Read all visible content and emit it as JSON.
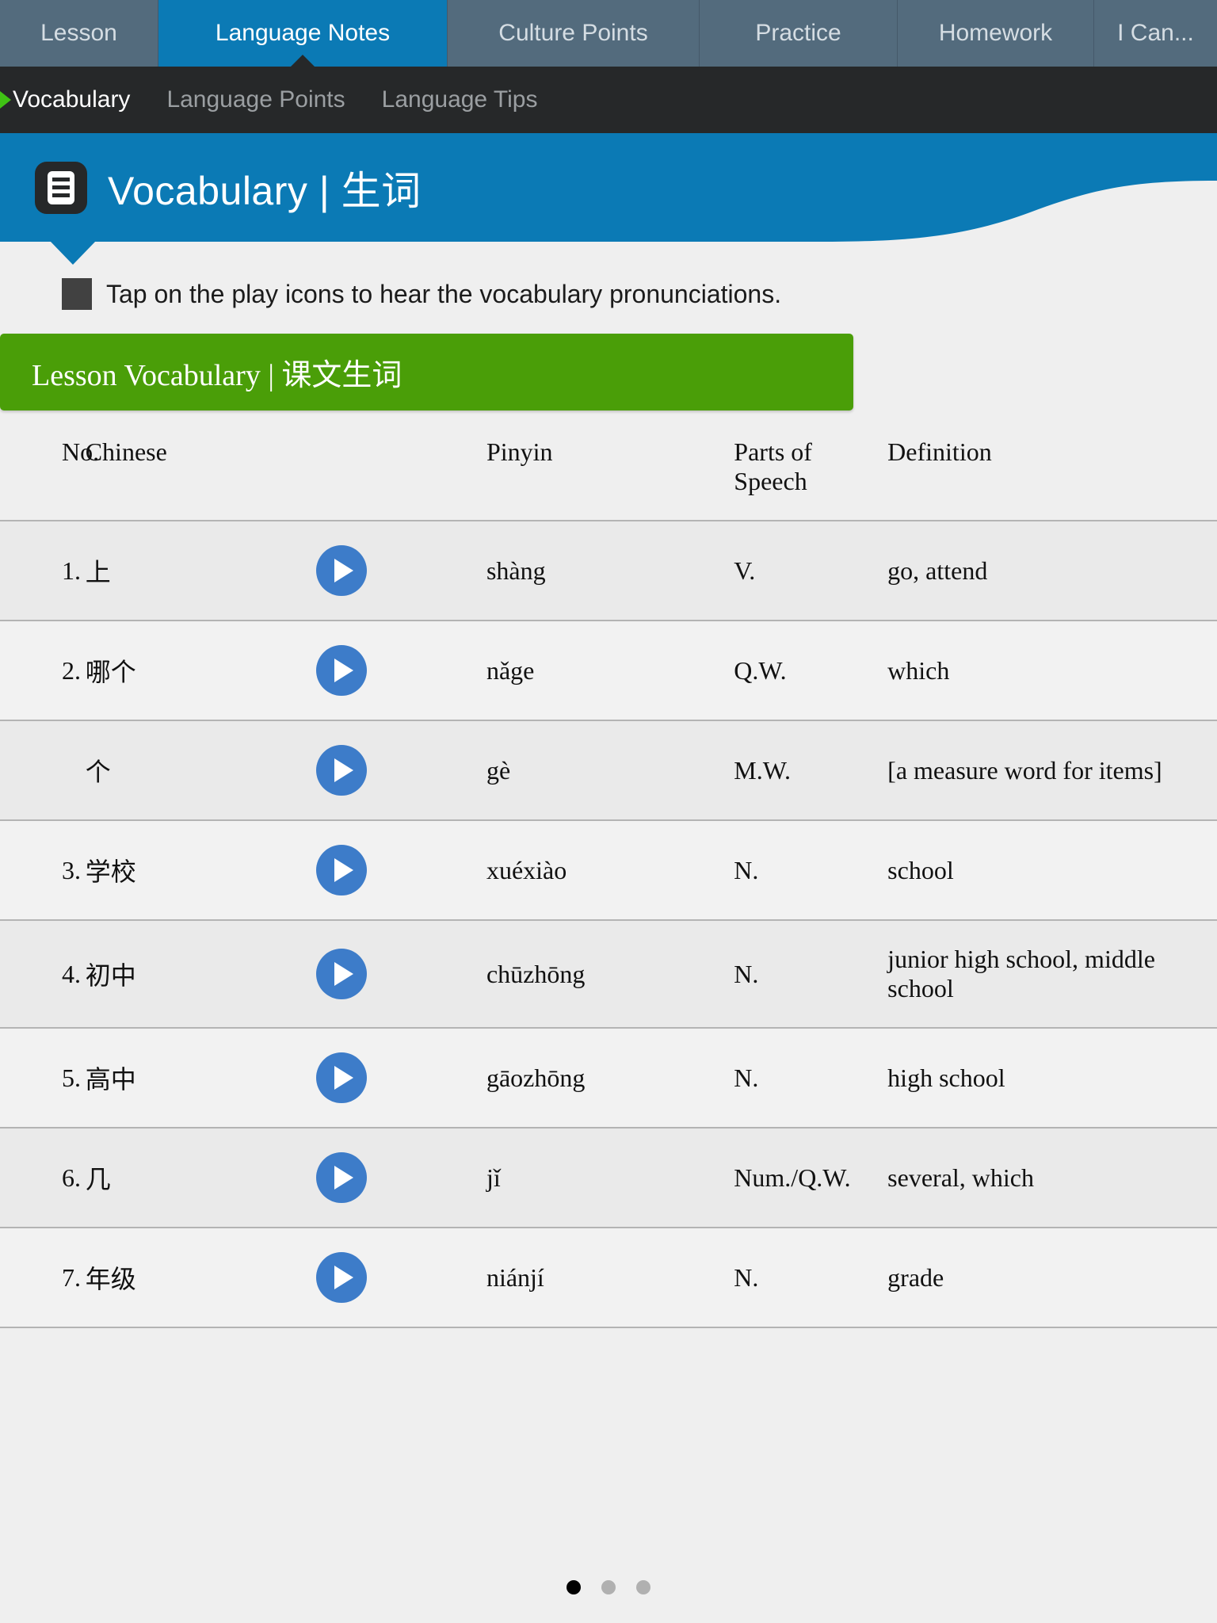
{
  "tabs": [
    {
      "label": "Lesson",
      "active": false
    },
    {
      "label": "Language Notes",
      "active": true
    },
    {
      "label": "Culture Points",
      "active": false
    },
    {
      "label": "Practice",
      "active": false
    },
    {
      "label": "Homework",
      "active": false
    },
    {
      "label": "I Can...",
      "active": false
    }
  ],
  "subnav": [
    {
      "label": "Vocabulary",
      "active": true
    },
    {
      "label": "Language Points",
      "active": false
    },
    {
      "label": "Language Tips",
      "active": false
    }
  ],
  "banner": {
    "title": "Vocabulary | 生词",
    "icon": "document-icon"
  },
  "instruction": {
    "text": "Tap on the play icons to hear the vocabulary pronunciations."
  },
  "section": {
    "title": "Lesson Vocabulary | 课文生词"
  },
  "table": {
    "headers": {
      "no": "No.",
      "chinese": "Chinese",
      "pinyin": "Pinyin",
      "pos": "Parts of Speech",
      "definition": "Definition"
    },
    "rows": [
      {
        "no": "1.",
        "chinese": "上",
        "play": "play-icon",
        "pinyin": "shàng",
        "pos": "V.",
        "definition": "go, attend"
      },
      {
        "no": "2.",
        "chinese": "哪个",
        "play": "play-icon",
        "pinyin": "nǎge",
        "pos": "Q.W.",
        "definition": "which"
      },
      {
        "no": "",
        "chinese": "个",
        "play": "play-icon",
        "pinyin": "gè",
        "pos": "M.W.",
        "definition": "[a measure word for items]"
      },
      {
        "no": "3.",
        "chinese": "学校",
        "play": "play-icon",
        "pinyin": "xuéxiào",
        "pos": "N.",
        "definition": "school"
      },
      {
        "no": "4.",
        "chinese": "初中",
        "play": "play-icon",
        "pinyin": "chūzhōng",
        "pos": "N.",
        "definition": "junior high school, middle school"
      },
      {
        "no": "5.",
        "chinese": "高中",
        "play": "play-icon",
        "pinyin": "gāozhōng",
        "pos": "N.",
        "definition": "high school"
      },
      {
        "no": "6.",
        "chinese": "几",
        "play": "play-icon",
        "pinyin": "jǐ",
        "pos": "Num./Q.W.",
        "definition": "several, which"
      },
      {
        "no": "7.",
        "chinese": "年级",
        "play": "play-icon",
        "pinyin": "niánjí",
        "pos": "N.",
        "definition": "grade"
      }
    ]
  },
  "pager": {
    "total": 3,
    "current": 1
  },
  "colors": {
    "tabbar": "#536b7d",
    "tab_active": "#0b7ab5",
    "subnav": "#262829",
    "banner": "#0b7ab5",
    "section_green": "#4a9e08",
    "play_blue": "#3d7cc9",
    "marker_green": "#3fc214",
    "page_bg": "#efefef"
  }
}
